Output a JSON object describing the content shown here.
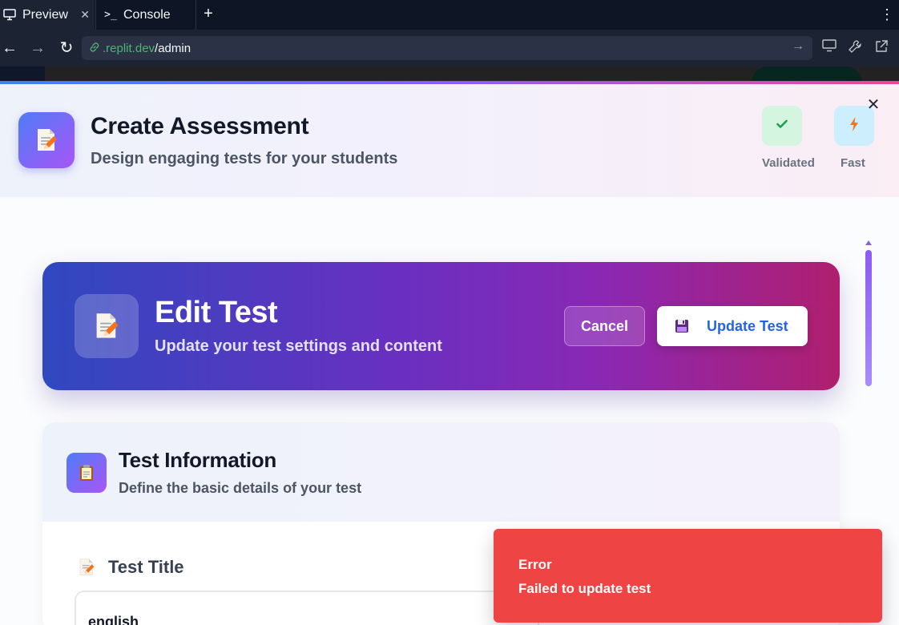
{
  "browser": {
    "tabs": [
      {
        "label": "Preview",
        "icon": "monitor-icon",
        "active": true
      },
      {
        "label": "Console",
        "icon": "terminal-icon",
        "active": false
      }
    ],
    "url_host": ".replit.dev",
    "url_path": "/admin"
  },
  "modal": {
    "title": "Create Assessment",
    "subtitle": "Design engaging tests for your students",
    "badges": [
      {
        "label": "Validated",
        "icon": "check-icon",
        "color": "#16a34a"
      },
      {
        "label": "Fast",
        "icon": "lightning-icon",
        "color": "#f97316"
      }
    ]
  },
  "hero": {
    "title": "Edit Test",
    "subtitle": "Update your test settings and content",
    "cancel_label": "Cancel",
    "update_label": "Update Test"
  },
  "test_info": {
    "title": "Test Information",
    "subtitle": "Define the basic details of your test",
    "field_label": "Test Title",
    "field_value": "english"
  },
  "toast": {
    "title": "Error",
    "message": "Failed to update test",
    "color": "#ef4444"
  }
}
